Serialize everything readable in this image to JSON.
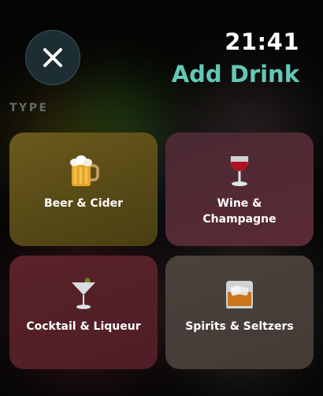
{
  "status": {
    "time": "21:41"
  },
  "header": {
    "title": "Add Drink",
    "close_icon": "close-x-icon"
  },
  "section": {
    "label": "TYPE"
  },
  "colors": {
    "accent": "#63c9b6",
    "section_label": "#5f6d6c"
  },
  "drink_types": [
    {
      "label": "Beer & Cider",
      "emoji": "🍺",
      "icon": "beer-mug-icon"
    },
    {
      "label": "Wine & Champagne",
      "emoji": "🍷",
      "icon": "wine-glass-icon"
    },
    {
      "label": "Cocktail & Liqueur",
      "emoji": "🍸",
      "icon": "cocktail-glass-icon"
    },
    {
      "label": "Spirits & Seltzers",
      "emoji": "🥃",
      "icon": "tumbler-glass-icon"
    }
  ]
}
